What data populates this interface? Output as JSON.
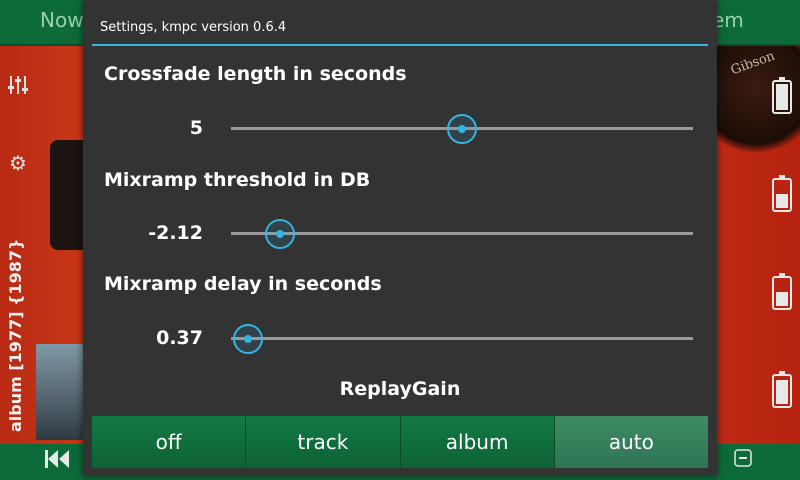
{
  "background": {
    "tabs": {
      "left_partial": "Now",
      "right_partial": "em"
    },
    "brand_logo": "Gibson",
    "vertical_text": "album  [1977] {1987}",
    "sidebar_icons": [
      "equalizer-icon",
      "gear-icon"
    ],
    "battery_levels": [
      1.0,
      0.55,
      0.55,
      0.9
    ]
  },
  "dialog": {
    "title": "Settings, kmpc version 0.6.4",
    "settings": [
      {
        "label": "Crossfade length in seconds",
        "value_text": "5",
        "fraction": 0.5
      },
      {
        "label": "Mixramp threshold in DB",
        "value_text": "-2.12",
        "fraction": 0.105
      },
      {
        "label": "Mixramp delay in seconds",
        "value_text": "0.37",
        "fraction": 0.037
      }
    ],
    "replaygain": {
      "title": "ReplayGain",
      "options": [
        "off",
        "track",
        "album",
        "auto"
      ],
      "selected": "auto"
    }
  },
  "colors": {
    "accent": "#33b5e5",
    "segment_green": "#0f6f3c",
    "dialog_bg": "#333333"
  }
}
